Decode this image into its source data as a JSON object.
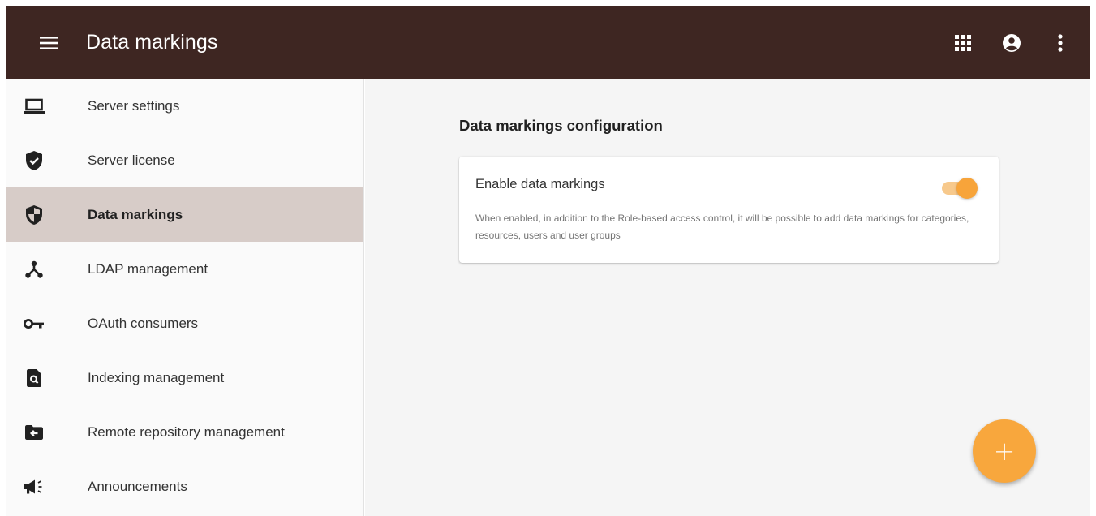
{
  "appbar": {
    "title": "Data markings",
    "menu_icon": "menu-icon",
    "actions": [
      "apps-icon",
      "account-icon",
      "more-vert-icon"
    ],
    "background": "#3e2622"
  },
  "sidebar": {
    "items": [
      {
        "label": "Server settings",
        "icon": "laptop-icon",
        "active": false
      },
      {
        "label": "Server license",
        "icon": "verified-shield-icon",
        "active": false
      },
      {
        "label": "Data markings",
        "icon": "security-shield-icon",
        "active": true
      },
      {
        "label": "LDAP management",
        "icon": "network-tree-icon",
        "active": false
      },
      {
        "label": "OAuth consumers",
        "icon": "key-icon",
        "active": false
      },
      {
        "label": "Indexing management",
        "icon": "find-in-page-icon",
        "active": false
      },
      {
        "label": "Remote repository management",
        "icon": "folder-arrow-icon",
        "active": false
      },
      {
        "label": "Announcements",
        "icon": "megaphone-icon",
        "active": false
      }
    ],
    "active_color": "#d7ccc8"
  },
  "main": {
    "section_title": "Data markings configuration",
    "card": {
      "label": "Enable data markings",
      "description": "When enabled, in addition to the Role-based access control, it will be possible to add data markings for categories, resources, users and user groups",
      "toggle_enabled": true
    },
    "fab": {
      "label": "+",
      "icon": "plus-icon",
      "color": "#f8a73d"
    }
  }
}
